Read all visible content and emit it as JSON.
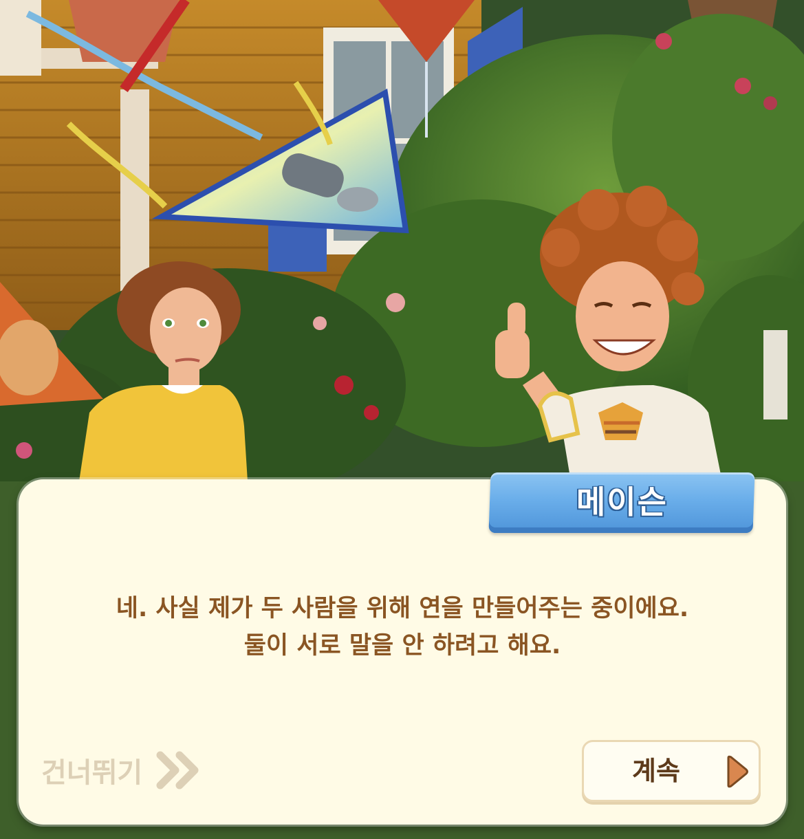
{
  "speaker": {
    "name": "메이슨"
  },
  "dialog": {
    "lines": [
      "네. 사실 제가 두 사람을 위해 연을 만들어주는 중이에요.",
      "둘이 서로 말을 안 하려고 해요."
    ]
  },
  "controls": {
    "skip_label": "건너뛰기",
    "skip_icon": "double-chevron-right-icon",
    "continue_label": "계속",
    "continue_icon": "play-arrow-icon"
  },
  "colors": {
    "dialog_bg": "#fffbe6",
    "dialog_text": "#8a5523",
    "name_tag": "#6aaeea",
    "skip_text": "#ddd0b6",
    "continue_text": "#5d3a1a",
    "continue_arrow": "#d9874f"
  }
}
